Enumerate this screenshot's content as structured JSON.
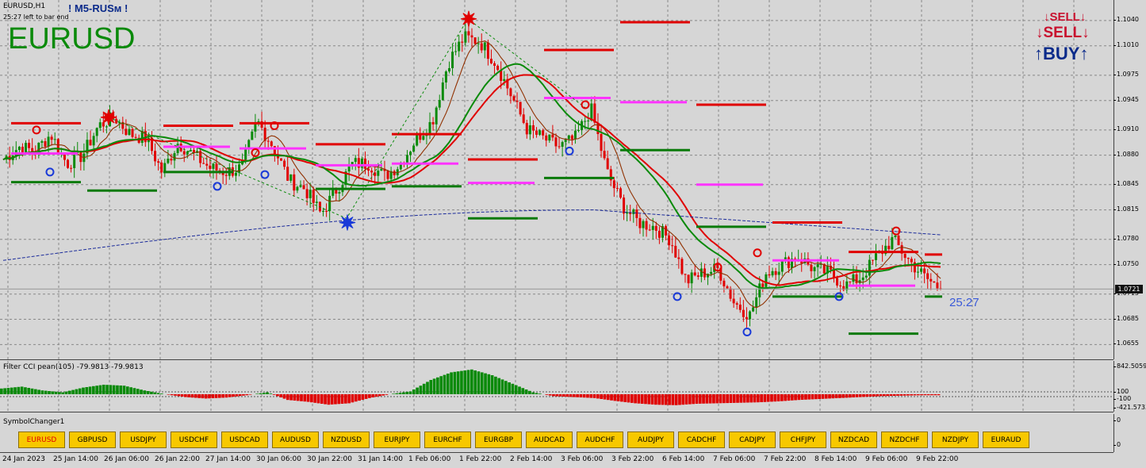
{
  "chart_header": {
    "symbol_timeframe": "EURUSD,H1",
    "bar_timer_text": "25:27 left to bar end",
    "big_symbol": "EURUSD",
    "indicator_tag": "! M5-RUSм !"
  },
  "signals": {
    "sell_small": "SELL",
    "sell_large": "SELL",
    "buy": "BUY",
    "colors": {
      "sell": "#c8102e",
      "buy": "#0a2a8a"
    }
  },
  "countdown": "25:27",
  "current_price": "1.0721",
  "price_scale": [
    "1.1040",
    "1.1010",
    "1.0975",
    "1.0945",
    "1.0910",
    "1.0880",
    "1.0845",
    "1.0815",
    "1.0780",
    "1.0750",
    "1.0715",
    "1.0685",
    "1.0655"
  ],
  "cci_pane": {
    "label": "Filter CCI pean(105) -79.9813 -79.9813",
    "scale": [
      "842.5059",
      "100",
      "-100",
      "-421.5733"
    ]
  },
  "symbol_changer": {
    "label": "SymbolChanger1",
    "scale": [
      "0",
      "0"
    ],
    "active": "EURUSD",
    "buttons": [
      "EURUSD",
      "GBPUSD",
      "USDJPY",
      "USDCHF",
      "USDCAD",
      "AUDUSD",
      "NZDUSD",
      "EURJPY",
      "EURCHF",
      "EURGBP",
      "AUDCAD",
      "AUDCHF",
      "AUDJPY",
      "CADCHF",
      "CADJPY",
      "CHFJPY",
      "NZDCAD",
      "NZDCHF",
      "NZDJPY",
      "EURAUD"
    ]
  },
  "time_axis": [
    "24 Jan 2023",
    "25 Jan 14:00",
    "26 Jan 06:00",
    "26 Jan 22:00",
    "27 Jan 14:00",
    "30 Jan 06:00",
    "30 Jan 22:00",
    "31 Jan 14:00",
    "1 Feb 06:00",
    "1 Feb 22:00",
    "2 Feb 14:00",
    "3 Feb 06:00",
    "3 Feb 22:00",
    "6 Feb 14:00",
    "7 Feb 06:00",
    "7 Feb 22:00",
    "8 Feb 14:00",
    "9 Feb 06:00",
    "9 Feb 22:00"
  ],
  "chart_data": {
    "type": "candlestick",
    "symbol": "EURUSD",
    "timeframe": "H1",
    "ylim": [
      1.0645,
      1.1055
    ],
    "price_path": [
      1.0875,
      1.089,
      1.0885,
      1.0905,
      1.087,
      1.088,
      1.0915,
      1.0925,
      1.0905,
      1.09,
      1.086,
      1.0895,
      1.088,
      1.0865,
      1.086,
      1.0865,
      1.092,
      1.089,
      1.085,
      1.084,
      1.081,
      1.084,
      1.087,
      1.087,
      1.0855,
      1.087,
      1.09,
      1.092,
      1.099,
      1.102,
      1.1015,
      1.099,
      1.095,
      1.091,
      1.09,
      1.089,
      1.09,
      1.0935,
      1.086,
      1.082,
      1.08,
      1.0795,
      1.078,
      1.073,
      1.074,
      1.0745,
      1.0705,
      1.069,
      1.074,
      1.075,
      1.076,
      1.0745,
      1.074,
      1.0725,
      1.0735,
      1.076,
      1.078,
      1.0755,
      1.0735,
      1.0721
    ],
    "cci_histogram": [
      60,
      80,
      40,
      20,
      70,
      100,
      90,
      40,
      0,
      -30,
      -45,
      -35,
      -10,
      20,
      -60,
      -80,
      -110,
      -95,
      -40,
      0,
      30,
      150,
      230,
      260,
      200,
      110,
      20,
      -20,
      -30,
      -40,
      -70,
      -95,
      -110,
      -115,
      -100,
      -95,
      -90,
      -85,
      -75,
      -60,
      -50,
      -40,
      -30,
      -20,
      -15,
      -10
    ],
    "moving_averages": [
      "red fast MA",
      "green MA",
      "blue dashed slow MA"
    ],
    "levels": {
      "resistance_color": "#e00000",
      "support_color": "#0a7a0a",
      "pivot_color": "#ff33ff"
    }
  }
}
